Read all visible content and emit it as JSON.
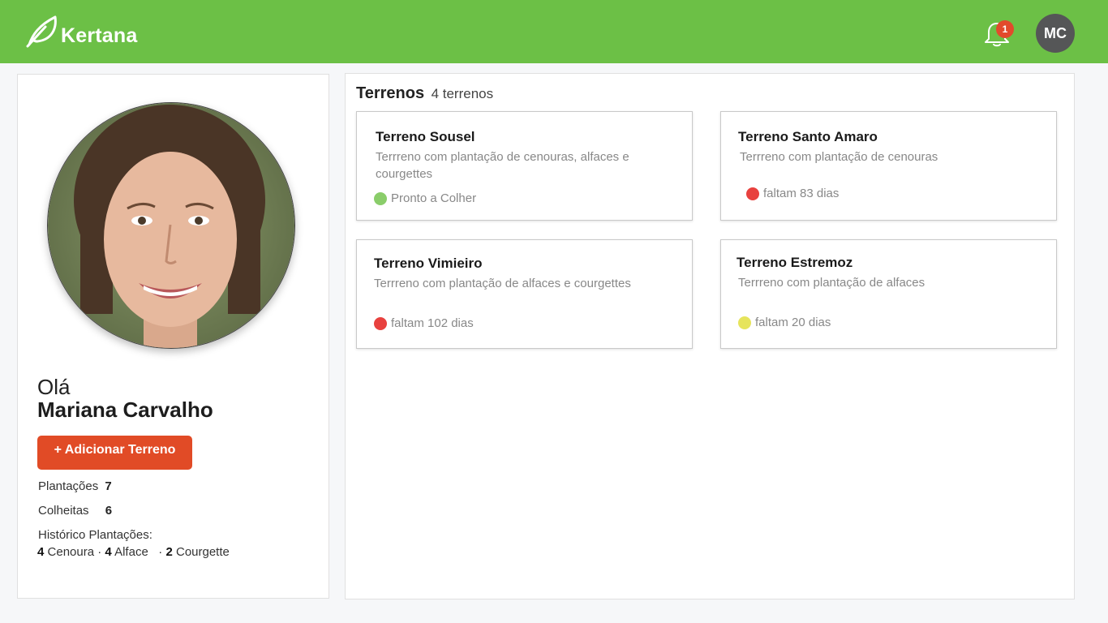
{
  "app": {
    "name": "Kertana"
  },
  "header": {
    "notification_count": "1",
    "user_initials": "MC"
  },
  "profile": {
    "greeting": "Olá",
    "name": "Mariana Carvalho",
    "add_button": "+ Adicionar Terreno",
    "stats": [
      {
        "label": "Plantações",
        "value": "7"
      },
      {
        "label": "Colheitas",
        "value": "6"
      }
    ],
    "history_title": "Histórico Plantações:",
    "history": [
      {
        "count": "4",
        "crop": "Cenoura"
      },
      {
        "count": "4",
        "crop": "Alface"
      },
      {
        "count": "2",
        "crop": "Courgette"
      }
    ]
  },
  "terrenos": {
    "title": "Terrenos",
    "count_label": "4 terrenos",
    "cards": [
      {
        "title": "Terreno Sousel",
        "description": "Terrreno com plantação de cenouras, alfaces e courgettes",
        "status": "Pronto a Colher",
        "status_color": "#8acd6a"
      },
      {
        "title": "Terreno Santo Amaro",
        "description": "Terrreno com plantação de cenouras",
        "status": "faltam 83 dias",
        "status_color": "#e8413e"
      },
      {
        "title": "Terreno Vimieiro",
        "description": "Terrreno com plantação de  alfaces e courgettes",
        "status": "faltam 102 dias",
        "status_color": "#e8413e"
      },
      {
        "title": "Terreno Estremoz",
        "description": "Terrreno com plantação de alfaces",
        "status": "faltam 20 dias",
        "status_color": "#e6e45c"
      }
    ]
  },
  "colors": {
    "header_green": "#6cc046",
    "accent_orange": "#e14b26",
    "badge_red": "#e24a2c"
  },
  "icons": [
    "leaf-icon",
    "bell-icon"
  ]
}
